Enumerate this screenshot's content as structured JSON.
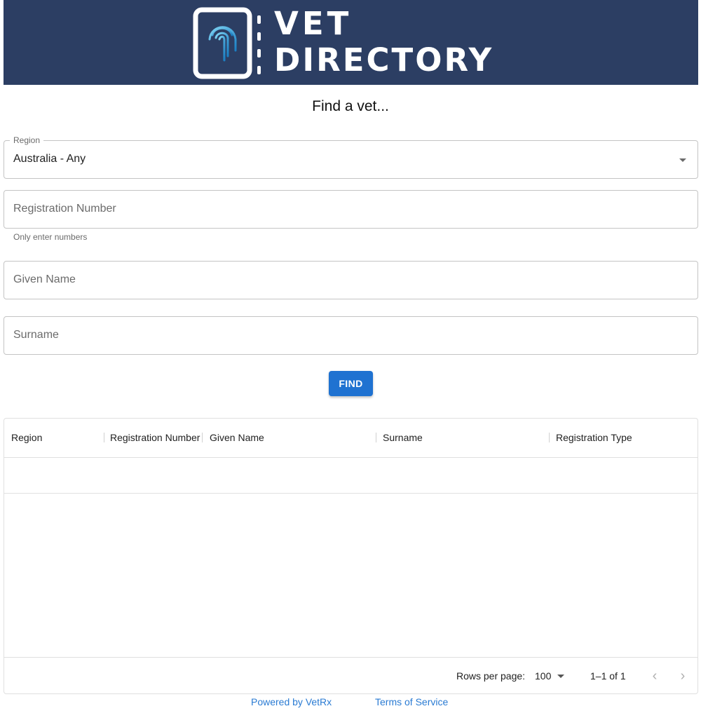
{
  "banner": {
    "logo_line1": "VET",
    "logo_line2": "DIRECTORY",
    "background": "#2c3e63",
    "icon": "fingerprint-icon"
  },
  "heading": "Find a vet...",
  "form": {
    "region": {
      "legend": "Region",
      "value": "Australia - Any"
    },
    "registration_number": {
      "placeholder": "Registration Number",
      "helper": "Only enter numbers"
    },
    "given_name": {
      "placeholder": "Given Name"
    },
    "surname": {
      "placeholder": "Surname"
    },
    "find_label": "FIND"
  },
  "table": {
    "columns": [
      "Region",
      "Registration Number",
      "Given Name",
      "Surname",
      "Registration Type"
    ],
    "rows": [],
    "rows_per_page_label": "Rows per page:",
    "rows_per_page": "100",
    "pagination": "1–1 of 1"
  },
  "footer": {
    "powered_by": "Powered by VetRx",
    "terms": "Terms of Service"
  },
  "colors": {
    "primary": "#1f72d1",
    "link": "#2a7bd3"
  }
}
